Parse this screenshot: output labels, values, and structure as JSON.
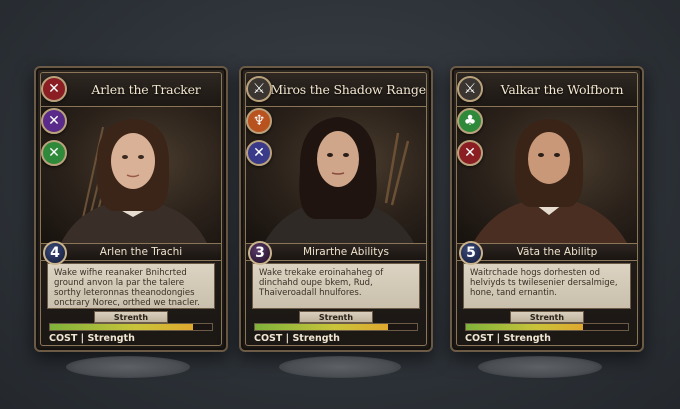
{
  "cards": [
    {
      "title": "Arlen the Tracker",
      "cost": "4",
      "name_bar": "Arlen the Trachi",
      "text": "Wake wifhe reanaker Bnihcrted ground anvon la par the talere sorthy leteronnas theanodongies onctrary Norec, orthed we tnacler.",
      "stat_label": "Strenth",
      "stat_fill": 0.88,
      "footer": "COST | Strength",
      "sigils": [
        {
          "icon": "crossed-arrows-icon",
          "glyph": "✕",
          "color": "#8a1e22"
        },
        {
          "icon": "crossed-swords-icon",
          "glyph": "✕",
          "color": "#5a2a8a"
        },
        {
          "icon": "crossed-blades-icon",
          "glyph": "✕",
          "color": "#2e8a3a"
        }
      ],
      "hair": "#3b2418",
      "skin": "#d8b196",
      "armor": "#3a2e28"
    },
    {
      "title": "Miros the Shadow Ranger",
      "cost": "3",
      "name_bar": "Mirarthe Abilitys",
      "text": "Wake trekake eroinahaheg of dinchahd oupe bkem, Rud, Thaiveroadall hnulfores.",
      "stat_label": "Strenth",
      "stat_fill": 0.82,
      "footer": "COST | Strength",
      "sigils": [
        {
          "icon": "sword-crest-icon",
          "glyph": "⚔",
          "color": "#3a3530"
        },
        {
          "icon": "flame-crest-icon",
          "glyph": "♆",
          "color": "#b8521e"
        },
        {
          "icon": "crossed-swords-icon",
          "glyph": "✕",
          "color": "#3a3a8a"
        }
      ],
      "hair": "#1f140f",
      "skin": "#cfa68a",
      "armor": "#2f2a26"
    },
    {
      "title": "Valkar the Wolfborn",
      "cost": "5",
      "name_bar": "Väta the Abilitp",
      "text": "Waitrchade hogs dorhesten od helviyds ts twilesenier dersalmige, hone, tand ernantin.",
      "stat_label": "Strenth",
      "stat_fill": 0.72,
      "footer": "COST | Strength",
      "sigils": [
        {
          "icon": "sword-crest-icon",
          "glyph": "⚔",
          "color": "#3a3530"
        },
        {
          "icon": "tree-crest-icon",
          "glyph": "♣",
          "color": "#2e8a3a"
        },
        {
          "icon": "crossed-swords-icon",
          "glyph": "✕",
          "color": "#8a1e22"
        }
      ],
      "hair": "#3a2418",
      "skin": "#c99878",
      "armor": "#4a2e22"
    }
  ]
}
